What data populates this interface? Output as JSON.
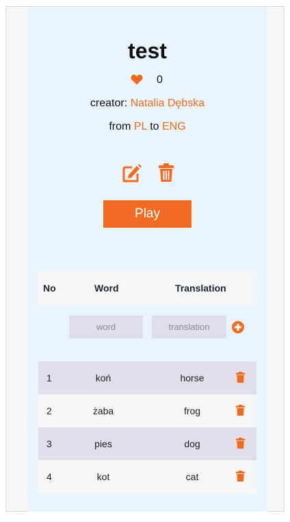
{
  "set": {
    "title": "test",
    "likes": "0",
    "creator_prefix": "creator: ",
    "creator_name": "Natalia Dębska",
    "from_prefix": "from ",
    "from_lang": "PL",
    "to_word": " to ",
    "to_lang": "ENG"
  },
  "actions": {
    "play_label": "Play",
    "edit_icon": "edit-icon",
    "delete_icon": "trash-icon"
  },
  "table": {
    "headers": {
      "no": "No",
      "word": "Word",
      "translation": "Translation"
    },
    "add_row": {
      "word_placeholder": "word",
      "translation_placeholder": "translation",
      "add_icon": "plus-circle-icon"
    },
    "rows": [
      {
        "no": "1",
        "word": "koń",
        "translation": "horse"
      },
      {
        "no": "2",
        "word": "żaba",
        "translation": "frog"
      },
      {
        "no": "3",
        "word": "pies",
        "translation": "dog"
      },
      {
        "no": "4",
        "word": "kot",
        "translation": "cat"
      }
    ]
  },
  "colors": {
    "accent": "#f26b22",
    "card_bg": "#e9f4fc",
    "row_alt": "#dfdeea"
  }
}
